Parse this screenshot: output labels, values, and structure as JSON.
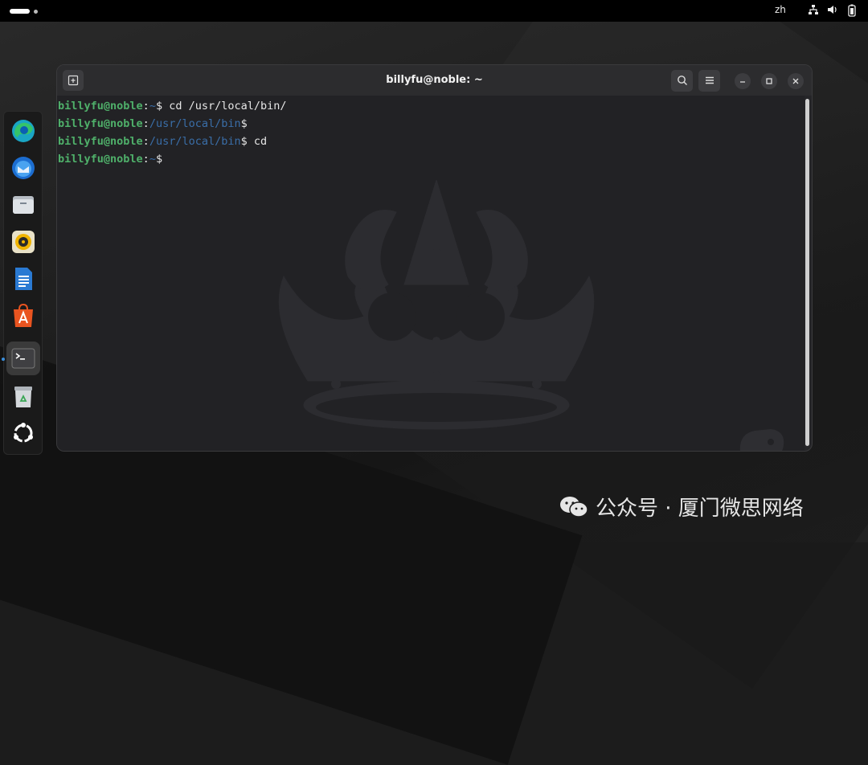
{
  "topbar": {
    "input_method": "zh",
    "tray_icons": [
      "network-icon",
      "volume-icon",
      "battery-icon"
    ]
  },
  "dock": {
    "apps": [
      {
        "name": "Microsoft Edge",
        "icon": "edge-icon"
      },
      {
        "name": "Thunderbird",
        "icon": "thunderbird-icon"
      },
      {
        "name": "Files",
        "icon": "files-icon"
      },
      {
        "name": "Rhythmbox",
        "icon": "rhythmbox-icon"
      },
      {
        "name": "LibreOffice Writer",
        "icon": "writer-icon"
      },
      {
        "name": "App Center",
        "icon": "app-center-icon"
      },
      {
        "name": "Terminal",
        "icon": "terminal-icon",
        "active": true
      },
      {
        "name": "Trash",
        "icon": "trash-icon"
      },
      {
        "name": "Show Apps",
        "icon": "ubuntu-icon"
      }
    ]
  },
  "terminal": {
    "title": "billyfu@noble: ~",
    "lines": [
      {
        "user": "billyfu@noble",
        "sep": ":",
        "path": "~",
        "prompt": "$ ",
        "cmd": "cd /usr/local/bin/"
      },
      {
        "user": "billyfu@noble",
        "sep": ":",
        "path": "/usr/local/bin",
        "prompt": "$",
        "cmd": ""
      },
      {
        "user": "billyfu@noble",
        "sep": ":",
        "path": "/usr/local/bin",
        "prompt": "$ ",
        "cmd": "cd"
      },
      {
        "user": "billyfu@noble",
        "sep": ":",
        "path": "~",
        "prompt": "$",
        "cmd": ""
      }
    ]
  },
  "colors": {
    "user": "#4fb06a",
    "path": "#3a6ea8",
    "accent": "#e95420"
  },
  "watermark": {
    "text": "公众号 · 厦门微思网络"
  }
}
